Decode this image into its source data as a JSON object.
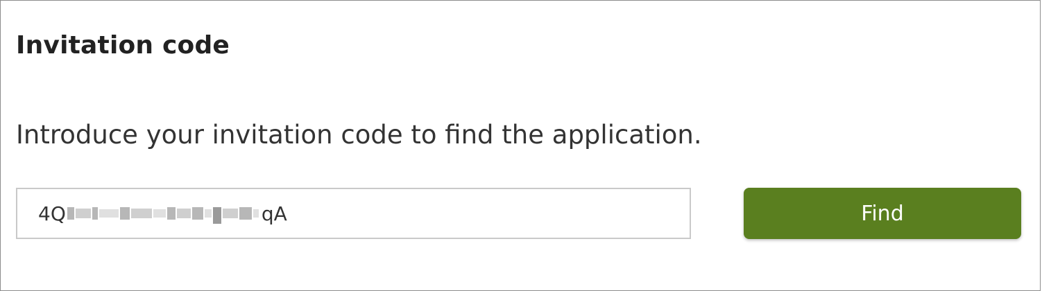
{
  "panel": {
    "title": "Invitation code",
    "instructions": "Introduce your invitation code to find the application."
  },
  "code_input": {
    "visible_prefix": "4Q",
    "visible_suffix": "qA",
    "middle_obscured": true
  },
  "find_button": {
    "label": "Find"
  },
  "colors": {
    "button_background": "#5a7f1f",
    "button_text": "#ffffff",
    "panel_border": "#8c8c8c",
    "input_border": "#c9c9c9"
  }
}
